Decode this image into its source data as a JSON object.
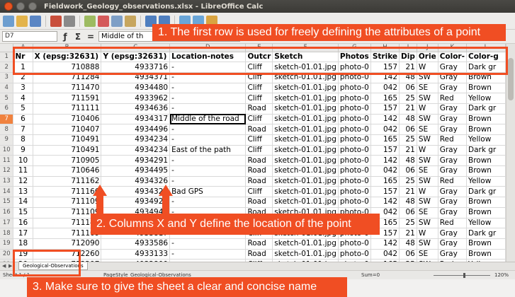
{
  "window": {
    "title": "Fieldwork_Geology_observations.xlsx - LibreOffice Calc"
  },
  "formula_bar": {
    "name_box": "D7",
    "content": "Middle of th"
  },
  "columns": [
    "A",
    "B",
    "C",
    "D",
    "E",
    "F",
    "G",
    "H",
    "I",
    "J",
    "K",
    "L"
  ],
  "header_row": [
    "Nr",
    "X (epsg:32631)",
    "Y (epsg:32631)",
    "Location-notes",
    "Outcr",
    "Sketch",
    "Photos",
    "Strike",
    "Dip",
    "Orie",
    "Color-",
    "Color-g"
  ],
  "rows": [
    [
      "1",
      "710888",
      "4933716",
      "-",
      "Cliff",
      "sketch-01.01.jpg",
      "photo-0",
      "157",
      "21",
      "W",
      "Gray",
      "Dark gr"
    ],
    [
      "2",
      "711284",
      "4934371",
      "-",
      "Cliff",
      "sketch-01.01.jpg",
      "photo-0",
      "142",
      "48",
      "SW",
      "Gray",
      "Brown"
    ],
    [
      "3",
      "711470",
      "4934480",
      "-",
      "Cliff",
      "sketch-01.01.jpg",
      "photo-0",
      "042",
      "06",
      "SE",
      "Gray",
      "Brown"
    ],
    [
      "4",
      "711591",
      "4933962",
      "-",
      "Cliff",
      "sketch-01.01.jpg",
      "photo-0",
      "165",
      "25",
      "SW",
      "Red",
      "Yellow"
    ],
    [
      "5",
      "711111",
      "4934636",
      "-",
      "Road",
      "sketch-01.01.jpg",
      "photo-0",
      "157",
      "21",
      "W",
      "Gray",
      "Dark gr"
    ],
    [
      "6",
      "710406",
      "4934317",
      "Middle of the road",
      "Cliff",
      "sketch-01.01.jpg",
      "photo-0",
      "142",
      "48",
      "SW",
      "Gray",
      "Brown"
    ],
    [
      "7",
      "710407",
      "4934496",
      "-",
      "Road",
      "sketch-01.01.jpg",
      "photo-0",
      "042",
      "06",
      "SE",
      "Gray",
      "Brown"
    ],
    [
      "8",
      "710491",
      "4934234",
      "-",
      "Cliff",
      "sketch-01.01.jpg",
      "photo-0",
      "165",
      "25",
      "SW",
      "Red",
      "Yellow"
    ],
    [
      "9",
      "710491",
      "4934234",
      "East of the path",
      "Cliff",
      "sketch-01.01.jpg",
      "photo-0",
      "157",
      "21",
      "W",
      "Gray",
      "Dark gr"
    ],
    [
      "10",
      "710905",
      "4934291",
      "-",
      "Road",
      "sketch-01.01.jpg",
      "photo-0",
      "142",
      "48",
      "SW",
      "Gray",
      "Brown"
    ],
    [
      "11",
      "710646",
      "4934495",
      "-",
      "Road",
      "sketch-01.01.jpg",
      "photo-0",
      "042",
      "06",
      "SE",
      "Gray",
      "Brown"
    ],
    [
      "12",
      "711162",
      "4934326",
      "-",
      "Road",
      "sketch-01.01.jpg",
      "photo-0",
      "165",
      "25",
      "SW",
      "Red",
      "Yellow"
    ],
    [
      "13",
      "711166",
      "4934321",
      "Bad GPS",
      "Cliff",
      "sketch-01.01.jpg",
      "photo-0",
      "157",
      "21",
      "W",
      "Gray",
      "Dark gr"
    ],
    [
      "14",
      "711109",
      "4934921",
      "-",
      "Road",
      "sketch-01.01.jpg",
      "photo-0",
      "142",
      "48",
      "SW",
      "Gray",
      "Brown"
    ],
    [
      "15",
      "711109",
      "4934945",
      "-",
      "Road",
      "sketch-01.01.jpg",
      "photo-0",
      "042",
      "06",
      "SE",
      "Gray",
      "Brown"
    ],
    [
      "16",
      "711140",
      "4934145",
      "-",
      "Cliff",
      "sketch-01.01.jpg",
      "photo-0",
      "165",
      "25",
      "SW",
      "Red",
      "Yellow"
    ],
    [
      "17",
      "711109",
      "4933817",
      "-",
      "Cliff",
      "sketch-01.01.jpg",
      "photo-0",
      "157",
      "21",
      "W",
      "Gray",
      "Dark gr"
    ],
    [
      "18",
      "712090",
      "4933586",
      "-",
      "Road",
      "sketch-01.01.jpg",
      "photo-0",
      "142",
      "48",
      "SW",
      "Gray",
      "Brown"
    ],
    [
      "19",
      "712260",
      "4933133",
      "-",
      "Road",
      "sketch-01.01.jpg",
      "photo-0",
      "042",
      "06",
      "SE",
      "Gray",
      "Brown"
    ],
    [
      "20",
      "712297",
      "4932800",
      "-",
      "Cliff",
      "sketch-01.01.jpg",
      "photo-0",
      "165",
      "25",
      "SW",
      "Red",
      "Yellow"
    ]
  ],
  "sheet": {
    "tab_name": "Geological-Observations",
    "status_sheet": "Sheet 1 / 1",
    "page_style": "PageStyle_Geological-Observations",
    "sum": "Sum=0",
    "zoom": "120%"
  },
  "annotations": {
    "callout1": "1. The first row is used for freely defining the attributes of a point",
    "callout2": "2. Columns X and Y define the location of the point",
    "callout3": "3. Make sure to give the sheet a clear and concise name"
  },
  "colors": {
    "accent": "#f04e23",
    "selection": "#f0823e"
  }
}
